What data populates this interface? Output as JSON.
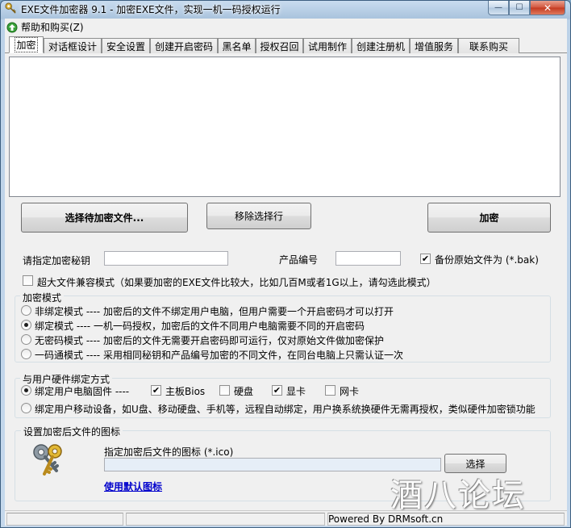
{
  "window": {
    "title": "EXE文件加密器 9.1 - 加密EXE文件，实现一机一码授权运行",
    "minimize_glyph": "—",
    "maximize_glyph": "☐",
    "close_glyph": "✕"
  },
  "menu": {
    "help_buy": "帮助和购买(Z)"
  },
  "tabs": [
    "加密",
    "对话框设计",
    "安全设置",
    "创建开启密码",
    "黑名单",
    "授权召回",
    "试用制作",
    "创建注册机",
    "增值服务",
    "联系购买"
  ],
  "actions": {
    "select_files": "选择待加密文件...",
    "remove_row": "移除选择行",
    "encrypt": "加密"
  },
  "fields": {
    "secret_key_label": "请指定加密秘钥",
    "secret_key_value": "",
    "product_id_label": "产品编号",
    "product_id_value": "",
    "backup_label": "备份原始文件为 (*.bak)",
    "backup_checked": true,
    "large_file_label": "超大文件兼容模式（如果要加密的EXE文件比较大，比如几百M或者1G以上，请勾选此模式）",
    "large_file_checked": false
  },
  "encrypt_mode": {
    "title": "加密模式",
    "options": [
      {
        "label": "非绑定模式 ---- 加密后的文件不绑定用户电脑，但用户需要一个开启密码才可以打开",
        "selected": false
      },
      {
        "label": "绑定模式 ---- 一机一码授权，加密后的文件不同用户电脑需要不同的开启密码",
        "selected": true
      },
      {
        "label": "无密码模式 ---- 加密后的文件无需要开启密码即可运行，仅对原始文件做加密保护",
        "selected": false
      },
      {
        "label": "一码通模式 ---- 采用相同秘钥和产品编号加密的不同文件，在同台电脑上只需认证一次",
        "selected": false
      }
    ]
  },
  "hardware": {
    "title": "与用户硬件绑定方式",
    "fixed_label": "绑定用户电脑固件 ----",
    "fixed_selected": true,
    "motherboard": "主板Bios",
    "motherboard_checked": true,
    "disk": "硬盘",
    "disk_checked": false,
    "gpu": "显卡",
    "gpu_checked": true,
    "nic": "网卡",
    "nic_checked": false,
    "mobile_label": "绑定用户移动设备，如U盘、移动硬盘、手机等，远程自动绑定，用户换系统换硬件无需再授权，类似硬件加密锁功能",
    "mobile_selected": false
  },
  "icon_settings": {
    "title": "设置加密后文件的图标",
    "prompt": "指定加密后文件的图标 (*.ico)",
    "path_value": "",
    "browse": "选择",
    "default_link": "使用默认图标"
  },
  "statusbar": {
    "text": "Powered By DRMsoft.cn"
  },
  "watermark": "酒八论坛",
  "colors": {
    "link": "#0000cc",
    "titlebar": "#a9c3dd"
  }
}
